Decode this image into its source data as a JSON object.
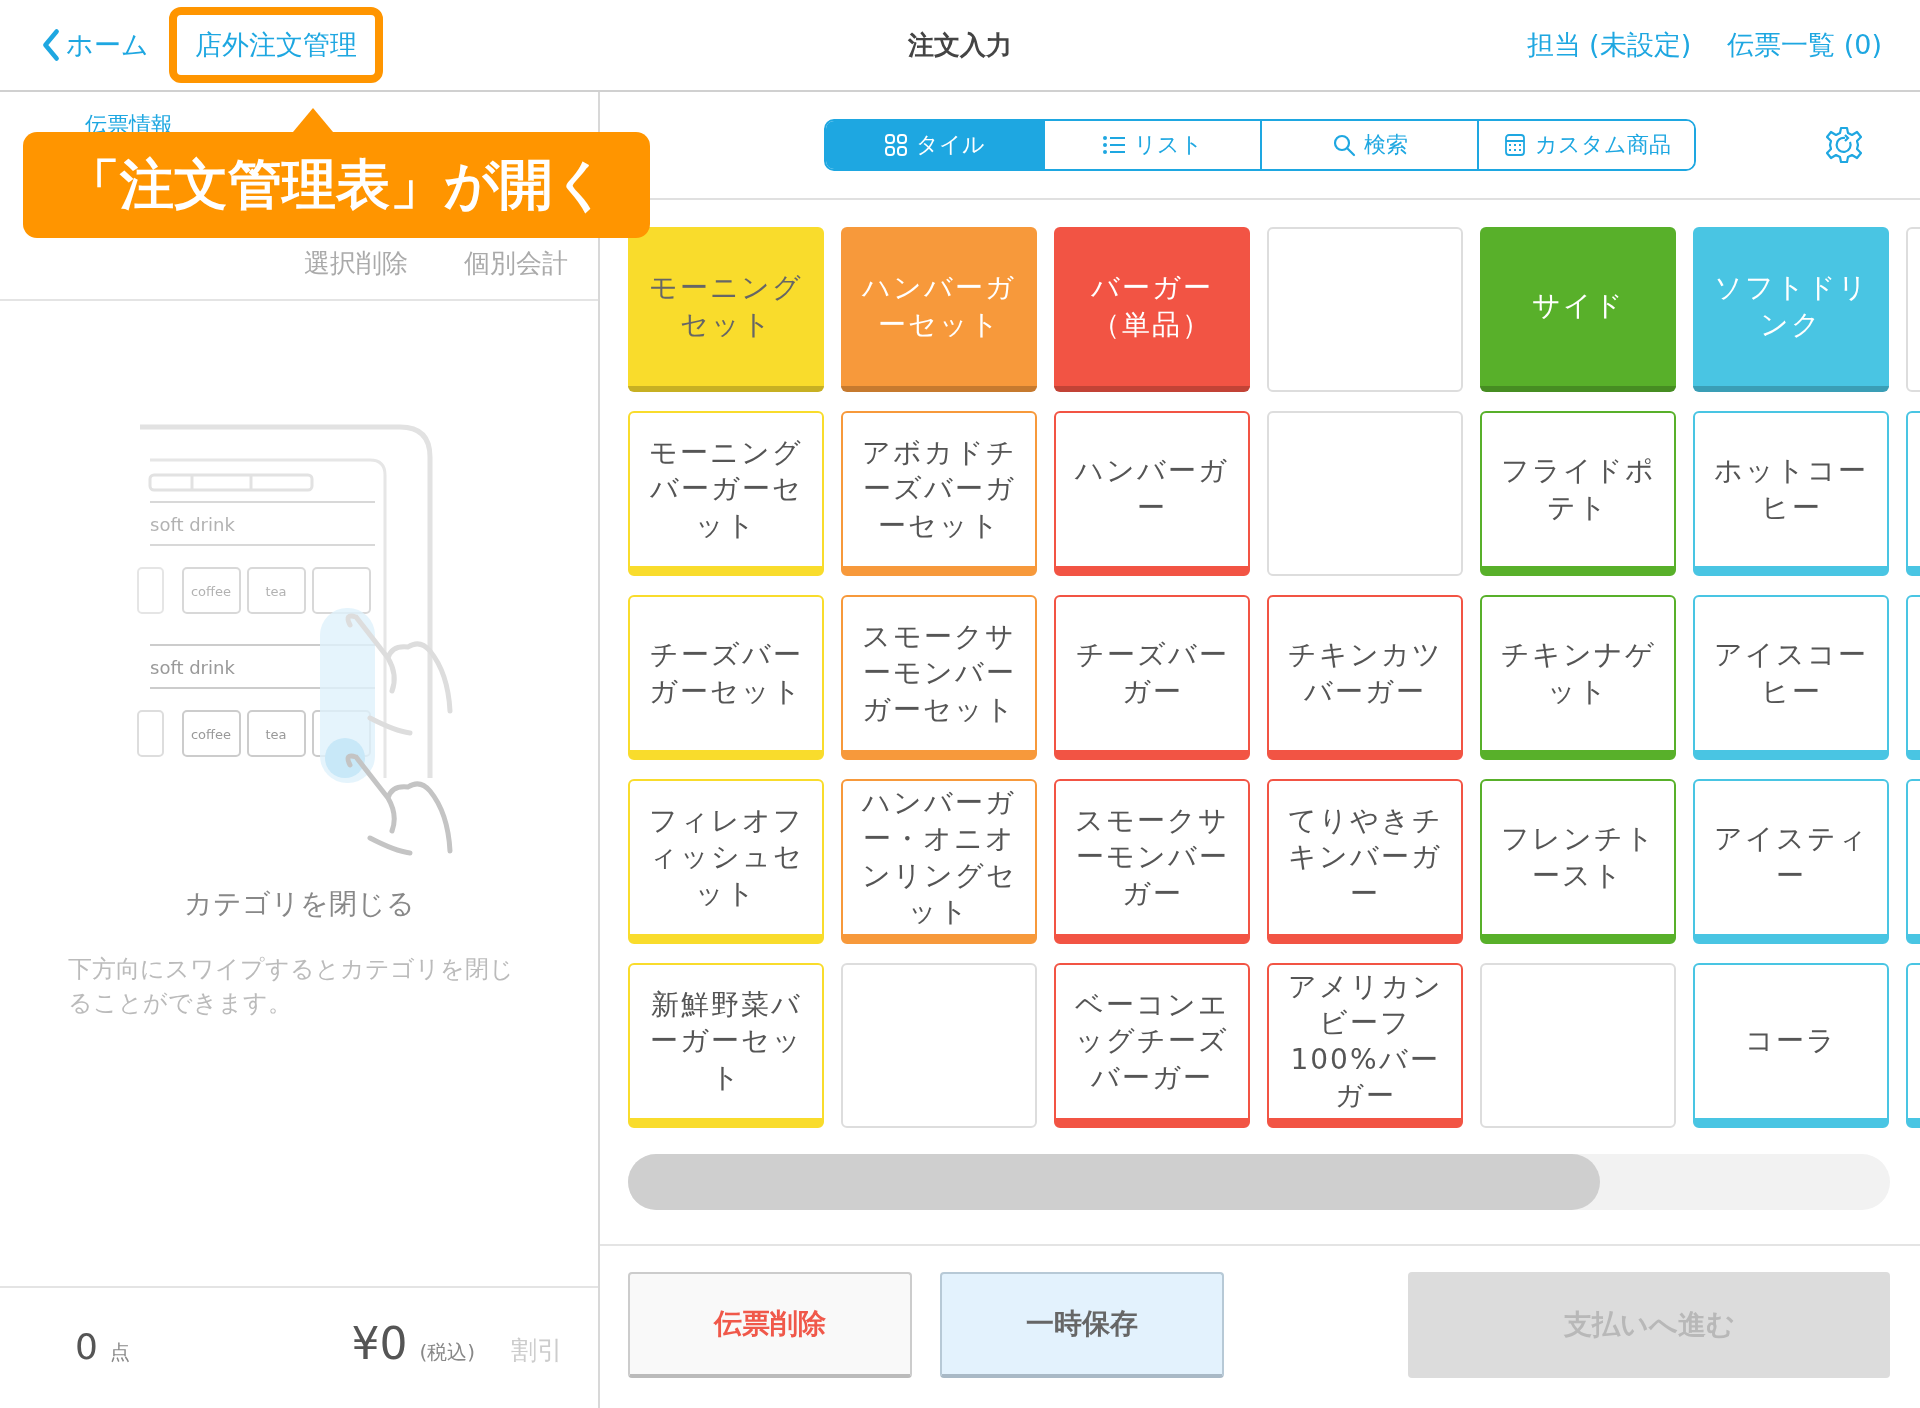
{
  "header": {
    "back": "ホーム",
    "highlighted_link": "店外注文管理",
    "title": "注文入力",
    "links": [
      "担当 (未設定)",
      "伝票一覧 (0)"
    ]
  },
  "callout": {
    "text": "「注文管理表」が開く"
  },
  "slip_panel": {
    "tab": "伝票情報",
    "actions": [
      "選択削除",
      "個別会計"
    ],
    "illustration": {
      "rows": [
        {
          "heading": "soft drink",
          "tiles": [
            "coffee",
            "tea"
          ]
        },
        {
          "heading": "soft drink",
          "tiles": [
            "coffee",
            "tea"
          ]
        }
      ]
    },
    "hint_title": "カテゴリを閉じる",
    "hint_text": "下方向にスワイプするとカテゴリを閉じることができます。",
    "count": "0",
    "count_unit": "点",
    "total": "¥0",
    "tax_note": "(税込)",
    "discount": "割引"
  },
  "view_tabs": [
    {
      "label": "タイル",
      "kind": "tile",
      "selected": true
    },
    {
      "label": "リスト",
      "kind": "list",
      "selected": false
    },
    {
      "label": "検索",
      "kind": "search",
      "selected": false
    },
    {
      "label": "カスタム商品",
      "kind": "custom",
      "selected": false
    }
  ],
  "tiles": [
    [
      {
        "kind": "category",
        "label": "モーニングセット",
        "color": "#f9dc2c"
      },
      {
        "kind": "category",
        "label": "ハンバーガーセット",
        "color": "#f7993b"
      },
      {
        "kind": "category",
        "label": "バーガー（単品）",
        "color": "#f25444"
      },
      {
        "kind": "empty"
      },
      {
        "kind": "category",
        "label": "サイド",
        "color": "#58b02a"
      },
      {
        "kind": "category",
        "label": "ソフトドリンク",
        "color": "#49c5e3"
      },
      {
        "kind": "empty"
      }
    ],
    [
      {
        "kind": "item",
        "label": "モーニングバーガーセット",
        "color": "#f9dc2c"
      },
      {
        "kind": "item",
        "label": "アボカドチーズバーガーセット",
        "color": "#f7993b"
      },
      {
        "kind": "item",
        "label": "ハンバーガー",
        "color": "#f25444"
      },
      {
        "kind": "empty"
      },
      {
        "kind": "item",
        "label": "フライドポテト",
        "color": "#58b02a"
      },
      {
        "kind": "item",
        "label": "ホットコーヒー",
        "color": "#49c5e3"
      },
      {
        "kind": "item",
        "color": "#49c5e3"
      }
    ],
    [
      {
        "kind": "item",
        "label": "チーズバーガーセット",
        "color": "#f9dc2c"
      },
      {
        "kind": "item",
        "label": "スモークサーモンバーガーセット",
        "color": "#f7993b"
      },
      {
        "kind": "item",
        "label": "チーズバーガー",
        "color": "#f25444"
      },
      {
        "kind": "item",
        "label": "チキンカツバーガー",
        "color": "#f25444"
      },
      {
        "kind": "item",
        "label": "チキンナゲット",
        "color": "#58b02a"
      },
      {
        "kind": "item",
        "label": "アイスコーヒー",
        "color": "#49c5e3"
      },
      {
        "kind": "item",
        "color": "#49c5e3"
      }
    ],
    [
      {
        "kind": "item",
        "label": "フィレオフィッシュセット",
        "color": "#f9dc2c"
      },
      {
        "kind": "item",
        "label": "ハンバーガー・オニオンリングセット",
        "color": "#f7993b"
      },
      {
        "kind": "item",
        "label": "スモークサーモンバーガー",
        "color": "#f25444"
      },
      {
        "kind": "item",
        "label": "てりやきチキンバーガー",
        "color": "#f25444"
      },
      {
        "kind": "item",
        "label": "フレンチトースト",
        "color": "#58b02a"
      },
      {
        "kind": "item",
        "label": "アイスティー",
        "color": "#49c5e3"
      },
      {
        "kind": "item",
        "color": "#49c5e3"
      }
    ],
    [
      {
        "kind": "item",
        "label": "新鮮野菜バーガーセット",
        "color": "#f9dc2c"
      },
      {
        "kind": "empty"
      },
      {
        "kind": "item",
        "label": "ベーコンエッグチーズバーガー",
        "color": "#f25444"
      },
      {
        "kind": "item",
        "label": "アメリカンビーフ100%バーガー",
        "color": "#f25444"
      },
      {
        "kind": "empty"
      },
      {
        "kind": "item",
        "label": "コーラ",
        "color": "#49c5e3"
      },
      {
        "kind": "item",
        "color": "#49c5e3"
      }
    ]
  ],
  "footer_buttons": [
    {
      "label": "伝票削除",
      "kind": "delete",
      "disabled": false
    },
    {
      "label": "一時保存",
      "kind": "save",
      "disabled": false
    },
    {
      "label": "支払いへ進む",
      "kind": "pay",
      "disabled": true
    }
  ]
}
